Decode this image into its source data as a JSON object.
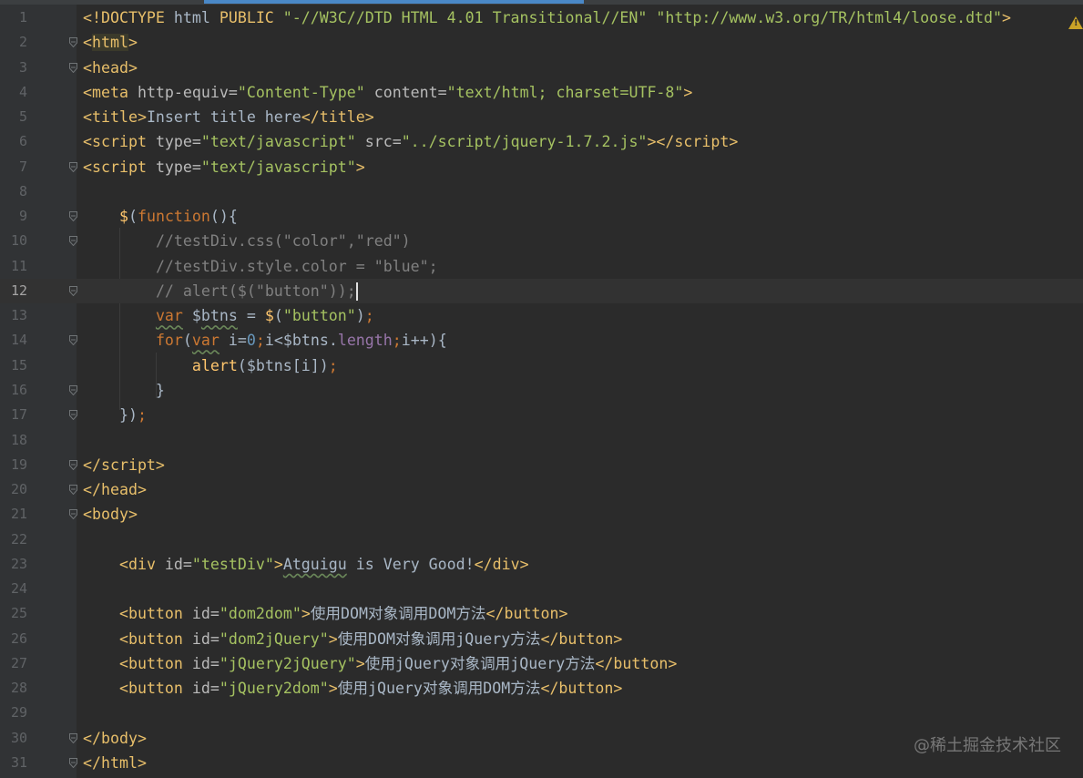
{
  "editor": {
    "current_line": 12,
    "fold_lines": [
      2,
      3,
      7,
      9,
      10,
      12,
      14,
      16,
      17,
      19,
      20,
      21,
      30,
      31
    ],
    "lines": [
      [
        [
          "tag",
          "<!DOCTYPE "
        ],
        [
          "text",
          "html "
        ],
        [
          "tag",
          "PUBLIC "
        ],
        [
          "str",
          "\"-//W3C//DTD HTML 4.01 Transitional//EN\" \"http://www.w3.org/TR/html4/loose.dtd\""
        ],
        [
          "tag",
          ">"
        ]
      ],
      [
        [
          "tag",
          "<"
        ],
        [
          "tag hl",
          "html"
        ],
        [
          "tag",
          ">"
        ]
      ],
      [
        [
          "tag",
          "<head>"
        ]
      ],
      [
        [
          "tag",
          "<meta "
        ],
        [
          "attr",
          "http-equiv="
        ],
        [
          "str",
          "\"Content-Type\" "
        ],
        [
          "attr",
          "content="
        ],
        [
          "str",
          "\"text/html; charset=UTF-8\""
        ],
        [
          "tag",
          ">"
        ]
      ],
      [
        [
          "tag",
          "<title>"
        ],
        [
          "text",
          "Insert title here"
        ],
        [
          "tag",
          "</title>"
        ]
      ],
      [
        [
          "tag",
          "<script "
        ],
        [
          "attr",
          "type="
        ],
        [
          "str",
          "\"text/javascript\" "
        ],
        [
          "attr",
          "src="
        ],
        [
          "str",
          "\"../script/jquery-1.7.2.js\""
        ],
        [
          "tag",
          "></script>"
        ]
      ],
      [
        [
          "tag",
          "<script "
        ],
        [
          "attr",
          "type="
        ],
        [
          "str",
          "\"text/javascript\""
        ],
        [
          "tag",
          ">"
        ]
      ],
      [],
      [
        [
          "text",
          "    "
        ],
        [
          "fn",
          "$"
        ],
        [
          "text",
          "("
        ],
        [
          "kw",
          "function"
        ],
        [
          "text",
          "(){"
        ]
      ],
      [
        [
          "text",
          "        "
        ],
        [
          "cmt",
          "//testDiv.css(\"color\",\"red\")"
        ]
      ],
      [
        [
          "text",
          "        "
        ],
        [
          "cmt",
          "//testDiv.style.color = \"blue\";"
        ]
      ],
      [
        [
          "text",
          "        "
        ],
        [
          "cmt",
          "// alert($(\"button\"));"
        ],
        [
          "caret",
          ""
        ]
      ],
      [
        [
          "text",
          "        "
        ],
        [
          "kw wavy",
          "var"
        ],
        [
          "text",
          " $"
        ],
        [
          "text wavy",
          "btns"
        ],
        [
          "text",
          " = "
        ],
        [
          "fn",
          "$"
        ],
        [
          "text",
          "("
        ],
        [
          "str",
          "\"button\""
        ],
        [
          "text",
          ")"
        ],
        [
          "punct",
          ";"
        ]
      ],
      [
        [
          "text",
          "        "
        ],
        [
          "kw",
          "for"
        ],
        [
          "text",
          "("
        ],
        [
          "kw wavy",
          "var"
        ],
        [
          "text",
          " i="
        ],
        [
          "num",
          "0"
        ],
        [
          "punct",
          ";"
        ],
        [
          "text",
          "i<$btns."
        ],
        [
          "prop",
          "length"
        ],
        [
          "punct",
          ";"
        ],
        [
          "text",
          "i++){"
        ]
      ],
      [
        [
          "text",
          "            "
        ],
        [
          "fn",
          "alert"
        ],
        [
          "text",
          "($btns[i])"
        ],
        [
          "punct",
          ";"
        ]
      ],
      [
        [
          "text",
          "        }"
        ]
      ],
      [
        [
          "text",
          "    })"
        ],
        [
          "punct",
          ";"
        ]
      ],
      [],
      [
        [
          "tag",
          "</script>"
        ]
      ],
      [
        [
          "tag",
          "</head>"
        ]
      ],
      [
        [
          "tag",
          "<body>"
        ]
      ],
      [],
      [
        [
          "text",
          "    "
        ],
        [
          "tag",
          "<div "
        ],
        [
          "attr",
          "id="
        ],
        [
          "str",
          "\"testDiv\""
        ],
        [
          "tag",
          ">"
        ],
        [
          "text wavy",
          "Atguigu"
        ],
        [
          "text",
          " is Very Good!"
        ],
        [
          "tag",
          "</div>"
        ]
      ],
      [],
      [
        [
          "text",
          "    "
        ],
        [
          "tag",
          "<button "
        ],
        [
          "attr",
          "id="
        ],
        [
          "str",
          "\"dom2dom\""
        ],
        [
          "tag",
          ">"
        ],
        [
          "text",
          "使用DOM对象调用DOM方法"
        ],
        [
          "tag",
          "</button>"
        ]
      ],
      [
        [
          "text",
          "    "
        ],
        [
          "tag",
          "<button "
        ],
        [
          "attr",
          "id="
        ],
        [
          "str",
          "\"dom2jQuery\""
        ],
        [
          "tag",
          ">"
        ],
        [
          "text",
          "使用DOM对象调用jQuery方法"
        ],
        [
          "tag",
          "</button>"
        ]
      ],
      [
        [
          "text",
          "    "
        ],
        [
          "tag",
          "<button "
        ],
        [
          "attr",
          "id="
        ],
        [
          "str",
          "\"jQuery2jQuery\""
        ],
        [
          "tag",
          ">"
        ],
        [
          "text",
          "使用jQuery对象调用jQuery方法"
        ],
        [
          "tag",
          "</button>"
        ]
      ],
      [
        [
          "text",
          "    "
        ],
        [
          "tag",
          "<button "
        ],
        [
          "attr",
          "id="
        ],
        [
          "str",
          "\"jQuery2dom\""
        ],
        [
          "tag",
          ">"
        ],
        [
          "text",
          "使用jQuery对象调用DOM方法"
        ],
        [
          "tag",
          "</button>"
        ]
      ],
      [],
      [
        [
          "tag",
          "</body>"
        ]
      ],
      [
        [
          "tag",
          "</html>"
        ]
      ]
    ]
  },
  "status": {
    "warning_icon": "warning-icon"
  },
  "watermark": "@稀土掘金技术社区"
}
